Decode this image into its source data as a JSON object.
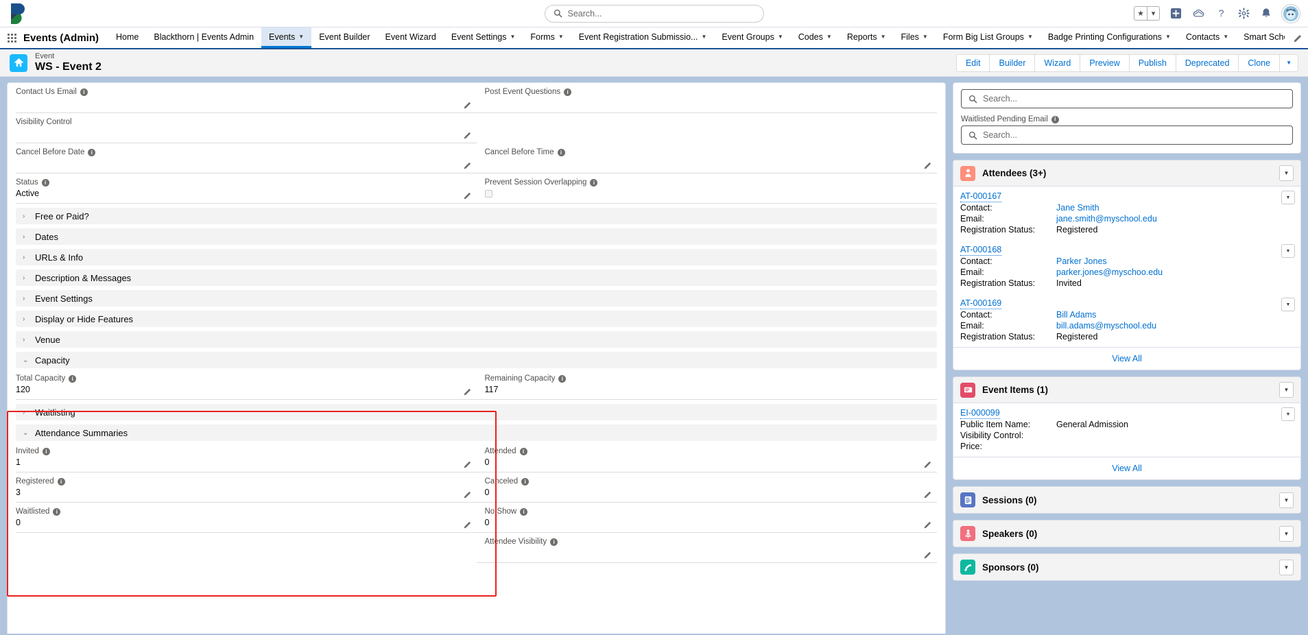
{
  "global_header": {
    "search_placeholder": "Search...",
    "search_icon": "search-icon",
    "icons": [
      {
        "name": "favorites-star-icon",
        "glyph": "★"
      },
      {
        "name": "favorites-dropdown-icon",
        "glyph": "▾"
      },
      {
        "name": "add-icon",
        "glyph": "+"
      },
      {
        "name": "cloud-icon",
        "glyph": "☁"
      },
      {
        "name": "help-icon",
        "glyph": "?"
      },
      {
        "name": "setup-gear-icon",
        "glyph": "⚙"
      },
      {
        "name": "notifications-bell-icon",
        "glyph": "🔔"
      }
    ],
    "avatar": "user-avatar"
  },
  "app_nav": {
    "app_name": "Events (Admin)",
    "items": [
      {
        "label": "Home",
        "has_caret": false,
        "active": false
      },
      {
        "label": "Blackthorn | Events Admin",
        "has_caret": false,
        "active": false
      },
      {
        "label": "Events",
        "has_caret": true,
        "active": true
      },
      {
        "label": "Event Builder",
        "has_caret": false,
        "active": false
      },
      {
        "label": "Event Wizard",
        "has_caret": false,
        "active": false
      },
      {
        "label": "Event Settings",
        "has_caret": true,
        "active": false
      },
      {
        "label": "Forms",
        "has_caret": true,
        "active": false
      },
      {
        "label": "Event Registration Submissio...",
        "has_caret": true,
        "active": false
      },
      {
        "label": "Event Groups",
        "has_caret": true,
        "active": false
      },
      {
        "label": "Codes",
        "has_caret": true,
        "active": false
      },
      {
        "label": "Reports",
        "has_caret": true,
        "active": false
      },
      {
        "label": "Files",
        "has_caret": true,
        "active": false
      },
      {
        "label": "Form Big List Groups",
        "has_caret": true,
        "active": false
      },
      {
        "label": "Badge Printing Configurations",
        "has_caret": true,
        "active": false
      },
      {
        "label": "Contacts",
        "has_caret": true,
        "active": false
      },
      {
        "label": "Smart Scheduler Admin",
        "has_caret": false,
        "active": false
      }
    ],
    "edit_nav_icon": "pencil-icon"
  },
  "record_header": {
    "object_type": "Event",
    "record_name": "WS - Event 2",
    "icon": "event-tent-icon",
    "icon_color": "#1ab9ff",
    "buttons": [
      "Edit",
      "Builder",
      "Wizard",
      "Preview",
      "Publish",
      "Deprecated",
      "Clone"
    ],
    "more_button_icon": "chevron-down-icon"
  },
  "detail": {
    "top_fields": [
      {
        "label": "Contact Us Email",
        "info": true,
        "value": "",
        "editable": true,
        "right_label": "Post Event Questions",
        "right_info": true,
        "right_value": "",
        "right_editable": false
      },
      {
        "label": "Visibility Control",
        "info": false,
        "value": "",
        "editable": true,
        "right_label": "",
        "right_info": false,
        "right_value": "",
        "right_editable": false
      },
      {
        "label": "Cancel Before Date",
        "info": true,
        "value": "",
        "editable": true,
        "right_label": "Cancel Before Time",
        "right_info": true,
        "right_value": "",
        "right_editable": true
      },
      {
        "label": "Status",
        "info": true,
        "value": "Active",
        "editable": true,
        "right_label": "Prevent Session Overlapping",
        "right_info": true,
        "right_value": "",
        "right_editable": false
      }
    ],
    "sections": [
      {
        "label": "Free or Paid?",
        "open": false
      },
      {
        "label": "Dates",
        "open": false
      },
      {
        "label": "URLs & Info",
        "open": false
      },
      {
        "label": "Description & Messages",
        "open": false
      },
      {
        "label": "Event Settings",
        "open": false
      },
      {
        "label": "Display or Hide Features",
        "open": false
      },
      {
        "label": "Venue",
        "open": false
      }
    ],
    "capacity": {
      "section_label": "Capacity",
      "open": true,
      "fields": [
        {
          "label": "Total Capacity",
          "info": true,
          "value": "120",
          "right_label": "Remaining Capacity",
          "right_info": true,
          "right_value": "117"
        }
      ]
    },
    "waitlisting": {
      "label": "Waitlisting",
      "open": false
    },
    "attendance_summaries": {
      "section_label": "Attendance Summaries",
      "open": true,
      "rows": [
        {
          "label": "Invited",
          "info": true,
          "value": "1",
          "right_label": "Attended",
          "right_info": true,
          "right_value": "0"
        },
        {
          "label": "Registered",
          "info": true,
          "value": "3",
          "right_label": "Canceled",
          "right_info": true,
          "right_value": "0"
        },
        {
          "label": "Waitlisted",
          "info": true,
          "value": "0",
          "right_label": "No Show",
          "right_info": true,
          "right_value": "0"
        },
        {
          "label": "",
          "info": false,
          "value": "",
          "right_label": "Attendee Visibility",
          "right_info": true,
          "right_value": ""
        }
      ]
    },
    "highlight_color": "#ea2020"
  },
  "sidebar": {
    "email_panel": {
      "top_search_placeholder": "Search...",
      "waitlisted_pending_email_label": "Waitlisted Pending Email",
      "waitlisted_pending_email_placeholder": "Search...",
      "search_icon": "search-icon"
    },
    "attendees": {
      "title": "Attendees (3+)",
      "icon": "attendee-icon",
      "icon_color": "#fe8f7d",
      "menu_icon": "chevron-down-icon",
      "view_all": "View All",
      "keys": {
        "contact": "Contact:",
        "email": "Email:",
        "status": "Registration Status:"
      },
      "records": [
        {
          "id": "AT-000167",
          "contact": "Jane Smith",
          "email": "jane.smith@myschool.edu",
          "status": "Registered"
        },
        {
          "id": "AT-000168",
          "contact": "Parker Jones",
          "email": "parker.jones@myschoo.edu",
          "status": "Invited"
        },
        {
          "id": "AT-000169",
          "contact": "Bill Adams",
          "email": "bill.adams@myschool.edu",
          "status": "Registered"
        }
      ]
    },
    "event_items": {
      "title": "Event Items (1)",
      "icon": "event-item-icon",
      "icon_color": "#e24c68",
      "menu_icon": "chevron-down-icon",
      "view_all": "View All",
      "keys": {
        "public_item_name": "Public Item Name:",
        "visibility_control": "Visibility Control:",
        "price": "Price:"
      },
      "records": [
        {
          "id": "EI-000099",
          "public_item_name": "General Admission",
          "visibility_control": "",
          "price": ""
        }
      ]
    },
    "empty_panels": [
      {
        "title": "Sessions (0)",
        "icon": "sessions-icon",
        "icon_color": "#5875c4",
        "menu_icon": "chevron-down-icon"
      },
      {
        "title": "Speakers (0)",
        "icon": "speakers-icon",
        "icon_color": "#f0707f",
        "menu_icon": "chevron-down-icon"
      },
      {
        "title": "Sponsors (0)",
        "icon": "sponsors-icon",
        "icon_color": "#0eb8a0",
        "menu_icon": "chevron-down-icon"
      }
    ]
  }
}
